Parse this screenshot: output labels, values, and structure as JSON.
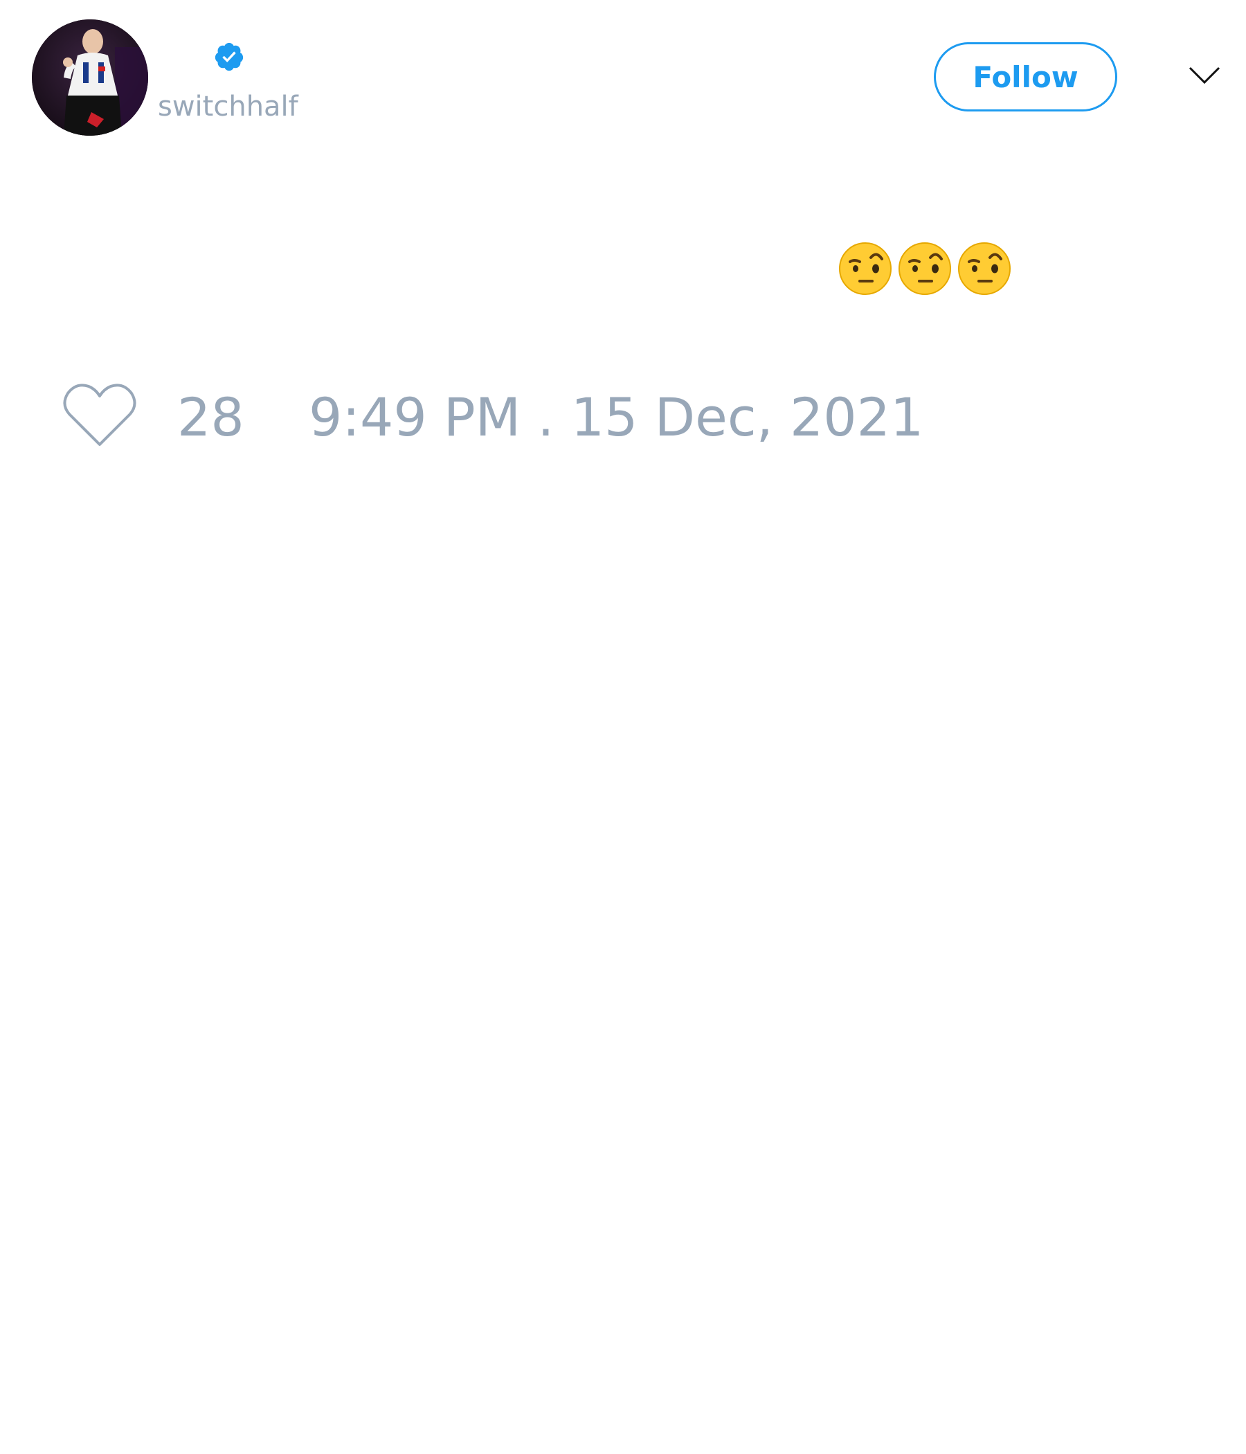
{
  "user": {
    "display_name": "",
    "handle": "switchhalf",
    "verified": true,
    "verified_color": "#1d9bf0"
  },
  "header": {
    "follow_label": "Follow",
    "menu_icon": "chevron-down-icon"
  },
  "tweet": {
    "emojis": [
      "face-with-raised-eyebrow",
      "face-with-raised-eyebrow",
      "face-with-raised-eyebrow"
    ]
  },
  "footer": {
    "like_icon": "heart-outline-icon",
    "like_count": "28",
    "timestamp": "9:49 PM . 15 Dec, 2021"
  },
  "colors": {
    "accent": "#1d9bf0",
    "muted_text": "#98a7b8",
    "background": "#ffffff"
  }
}
